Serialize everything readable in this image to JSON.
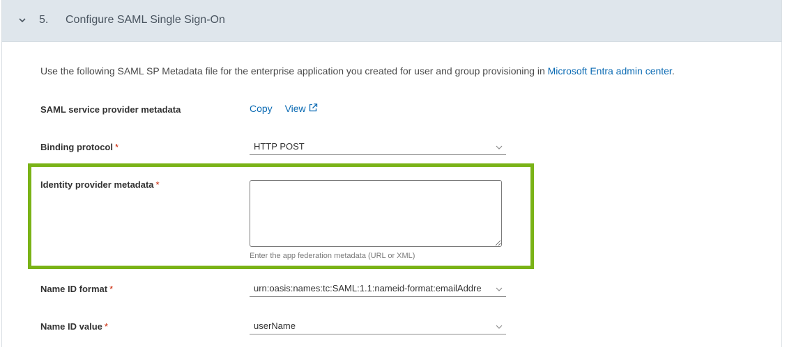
{
  "section": {
    "number": "5.",
    "title": "Configure SAML Single Sign-On",
    "expanded_icon": "chevron-down-icon"
  },
  "intro": {
    "text": "Use the following SAML SP Metadata file for the enterprise application you created for user and group provisioning in ",
    "link": "Microsoft Entra admin center",
    "suffix": "."
  },
  "sp_metadata": {
    "label": "SAML service provider metadata",
    "copy": "Copy",
    "view": "View",
    "view_icon": "external-link-icon"
  },
  "binding_protocol": {
    "label": "Binding protocol",
    "required": "*",
    "value": "HTTP POST"
  },
  "idp_metadata": {
    "label": "Identity provider metadata",
    "required": "*",
    "value": "",
    "helper": "Enter the app federation metadata (URL or XML)"
  },
  "name_id_format": {
    "label": "Name ID format",
    "required": "*",
    "value": "urn:oasis:names:tc:SAML:1.1:nameid-format:emailAddre"
  },
  "name_id_value": {
    "label": "Name ID value",
    "required": "*",
    "value": "userName"
  },
  "colors": {
    "header_bg": "#dfe6ec",
    "link": "#0a6ab3",
    "required": "#c92100",
    "highlight": "#7ab317"
  }
}
